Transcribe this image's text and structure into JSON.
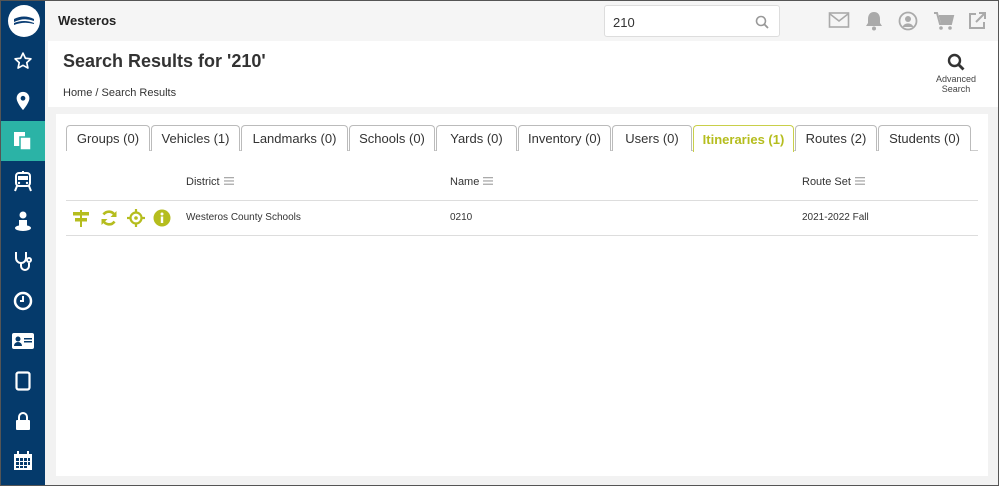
{
  "app": {
    "title": "Westeros"
  },
  "search": {
    "value": "210",
    "placeholder": ""
  },
  "header": {
    "title": "Search Results for '210'",
    "breadcrumb": "Home / Search Results",
    "advanced_search_line1": "Advanced",
    "advanced_search_line2": "Search"
  },
  "sidebar": {
    "items": [
      {
        "icon": "star-icon"
      },
      {
        "icon": "map-pin-icon"
      },
      {
        "icon": "documents-icon",
        "active": true
      },
      {
        "icon": "bus-icon"
      },
      {
        "icon": "student-icon"
      },
      {
        "icon": "stethoscope-icon"
      },
      {
        "icon": "clock-icon"
      },
      {
        "icon": "id-card-icon"
      },
      {
        "icon": "tablet-icon"
      },
      {
        "icon": "lock-icon"
      },
      {
        "icon": "calendar-icon"
      }
    ]
  },
  "topbar_icons": [
    "mail-icon",
    "bell-icon",
    "user-icon",
    "cart-icon",
    "external-link-icon"
  ],
  "tabs": [
    {
      "label": "Groups (0)"
    },
    {
      "label": "Vehicles (1)"
    },
    {
      "label": "Landmarks (0)"
    },
    {
      "label": "Schools (0)"
    },
    {
      "label": "Yards (0)"
    },
    {
      "label": "Inventory (0)"
    },
    {
      "label": "Users (0)"
    },
    {
      "label": "Itineraries (1)",
      "active": true
    },
    {
      "label": "Routes (2)"
    },
    {
      "label": "Students (0)"
    }
  ],
  "table": {
    "columns": [
      "District",
      "Name",
      "Route Set"
    ],
    "rows": [
      {
        "district": "Westeros County Schools",
        "name": "0210",
        "route_set": "2021-2022 Fall"
      }
    ],
    "row_actions": [
      "signpost-icon",
      "refresh-icon",
      "locate-icon",
      "info-icon"
    ]
  },
  "colors": {
    "sidebar": "#053a6b",
    "sidebar_active": "#2bb3a6",
    "accent": "#b5bd1e"
  }
}
